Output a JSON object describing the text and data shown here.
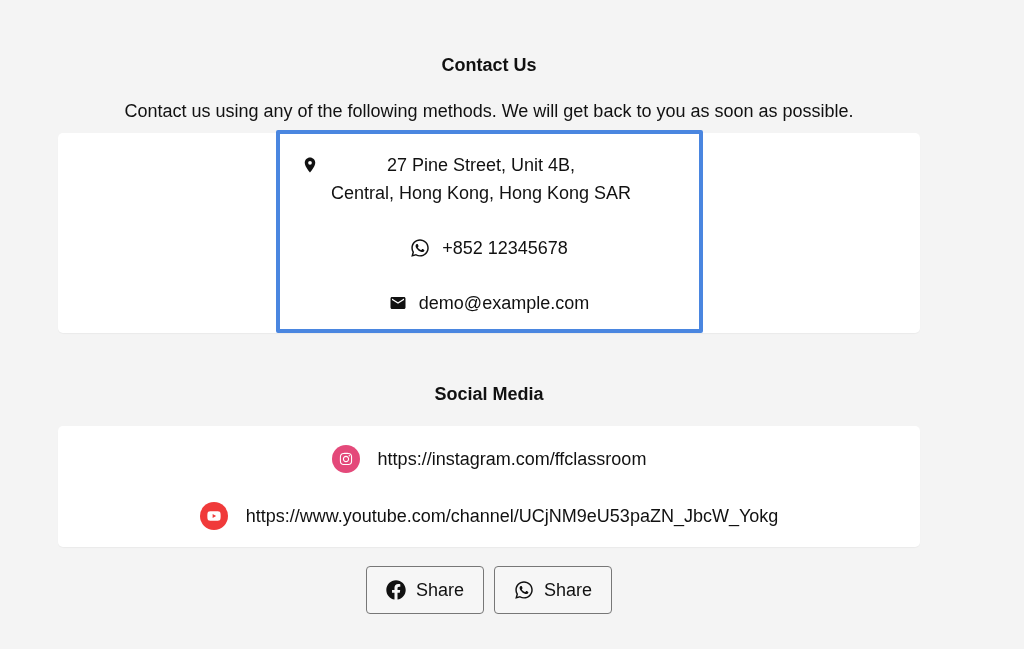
{
  "contact": {
    "title": "Contact Us",
    "intro": "Contact us using any of the following methods. We will get back to you as soon as possible.",
    "focused": true,
    "items": [
      {
        "kind": "address",
        "lines": [
          "27 Pine Street, Unit 4B,",
          "Central, Hong Kong, Hong Kong SAR"
        ]
      },
      {
        "kind": "phone",
        "lines": [
          "+852 12345678"
        ]
      },
      {
        "kind": "email",
        "lines": [
          "demo@example.com"
        ]
      }
    ]
  },
  "social": {
    "title": "Social Media",
    "items": [
      {
        "kind": "instagram",
        "color": "#e4497a",
        "url": "https://instagram.com/ffclassroom"
      },
      {
        "kind": "youtube",
        "color": "#f03a3a",
        "url": "https://www.youtube.com/channel/UCjNM9eU53paZN_JbcW_Yokg"
      }
    ]
  },
  "share_buttons": [
    {
      "kind": "facebook",
      "label": "Share"
    },
    {
      "kind": "whatsapp",
      "label": "Share"
    }
  ]
}
